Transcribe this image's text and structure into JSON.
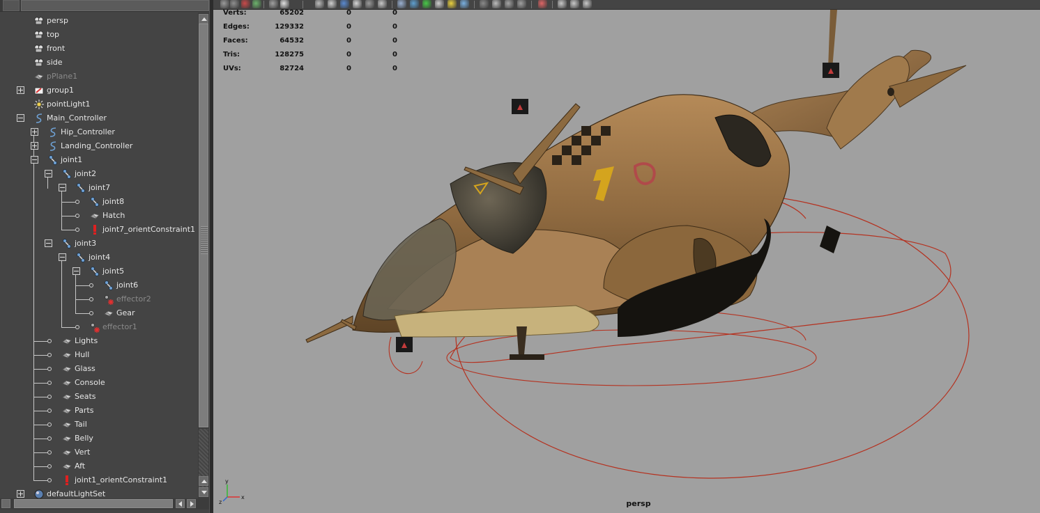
{
  "outliner": {
    "items": [
      {
        "label": "persp",
        "icon": "camera-icon"
      },
      {
        "label": "top",
        "icon": "camera-icon"
      },
      {
        "label": "front",
        "icon": "camera-icon"
      },
      {
        "label": "side",
        "icon": "camera-icon"
      },
      {
        "label": "pPlane1",
        "icon": "mesh-icon"
      },
      {
        "label": "group1",
        "icon": "group-icon"
      },
      {
        "label": "pointLight1",
        "icon": "point-light-icon"
      },
      {
        "label": "Main_Controller",
        "icon": "curve-icon"
      },
      {
        "label": "Hip_Controller",
        "icon": "curve-icon"
      },
      {
        "label": "Landing_Controller",
        "icon": "curve-icon"
      },
      {
        "label": "joint1",
        "icon": "joint-icon"
      },
      {
        "label": "joint2",
        "icon": "joint-icon"
      },
      {
        "label": "joint7",
        "icon": "joint-icon"
      },
      {
        "label": "joint8",
        "icon": "joint-icon"
      },
      {
        "label": "Hatch",
        "icon": "mesh-icon"
      },
      {
        "label": "joint7_orientConstraint1",
        "icon": "constraint-icon"
      },
      {
        "label": "joint3",
        "icon": "joint-icon"
      },
      {
        "label": "joint4",
        "icon": "joint-icon"
      },
      {
        "label": "joint5",
        "icon": "joint-icon"
      },
      {
        "label": "joint6",
        "icon": "joint-icon"
      },
      {
        "label": "effector2",
        "icon": "effector-icon"
      },
      {
        "label": "Gear",
        "icon": "mesh-icon"
      },
      {
        "label": "effector1",
        "icon": "effector-icon"
      },
      {
        "label": "Lights",
        "icon": "mesh-icon"
      },
      {
        "label": "Hull",
        "icon": "mesh-icon"
      },
      {
        "label": "Glass",
        "icon": "mesh-icon"
      },
      {
        "label": "Console",
        "icon": "mesh-icon"
      },
      {
        "label": "Seats",
        "icon": "mesh-icon"
      },
      {
        "label": "Parts",
        "icon": "mesh-icon"
      },
      {
        "label": "Tail",
        "icon": "mesh-icon"
      },
      {
        "label": "Belly",
        "icon": "mesh-icon"
      },
      {
        "label": "Vert",
        "icon": "mesh-icon"
      },
      {
        "label": "Aft",
        "icon": "mesh-icon"
      },
      {
        "label": "joint1_orientConstraint1",
        "icon": "constraint-icon"
      },
      {
        "label": "defaultLightSet",
        "icon": "light-set-icon"
      }
    ]
  },
  "hud": {
    "rows": [
      {
        "label": "Verts:",
        "values": [
          "65202",
          "0",
          "0"
        ]
      },
      {
        "label": "Edges:",
        "values": [
          "129332",
          "0",
          "0"
        ]
      },
      {
        "label": "Faces:",
        "values": [
          "64532",
          "0",
          "0"
        ]
      },
      {
        "label": "Tris:",
        "values": [
          "128275",
          "0",
          "0"
        ]
      },
      {
        "label": "UVs:",
        "values": [
          "82724",
          "0",
          "0"
        ]
      }
    ]
  },
  "viewport": {
    "camera_label": "persp"
  },
  "colors": {
    "panel_bg": "#444444",
    "viewport_bg": "#a0a0a0",
    "hud_text": "#111111",
    "controller_curve": "#c0392b",
    "hull": "#9a7246"
  }
}
